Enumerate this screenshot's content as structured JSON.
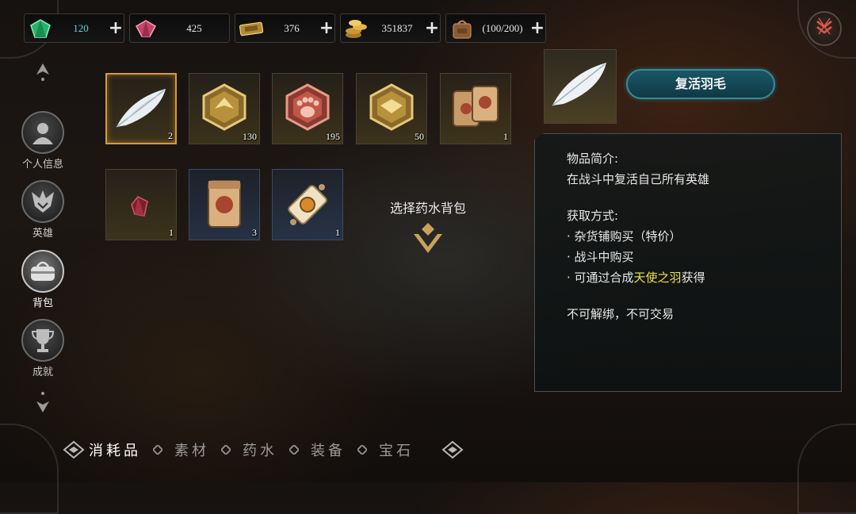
{
  "resources": [
    {
      "id": "emerald",
      "value": "120",
      "icon": "green-gem-icon",
      "color": "#5fd6c9"
    },
    {
      "id": "ruby",
      "value": "425",
      "icon": "pink-gem-icon"
    },
    {
      "id": "ticket",
      "value": "376",
      "icon": "gold-ticket-icon"
    },
    {
      "id": "gold",
      "value": "351837",
      "icon": "gold-coins-icon"
    },
    {
      "id": "bag",
      "value": "(100/200)",
      "icon": "backpack-icon"
    }
  ],
  "nav": {
    "items": [
      {
        "label": "个人信息",
        "icon": "profile-icon"
      },
      {
        "label": "英雄",
        "icon": "hero-emblem-icon"
      },
      {
        "label": "背包",
        "icon": "bag-icon"
      },
      {
        "label": "成就",
        "icon": "trophy-icon"
      }
    ],
    "active": "背包"
  },
  "inventory": {
    "row1": [
      {
        "item": "feather",
        "count": "2"
      },
      {
        "item": "gold-hexagon-token",
        "count": "130"
      },
      {
        "item": "red-paw-token",
        "count": "195"
      },
      {
        "item": "gold-crest-token",
        "count": "50"
      },
      {
        "item": "seed-bag-bundle",
        "count": "1"
      }
    ],
    "row2": [
      {
        "item": "red-crystal",
        "count": "1"
      },
      {
        "item": "seed-bag",
        "count": "3"
      },
      {
        "item": "scroll",
        "count": "1"
      }
    ]
  },
  "potion_hint": "选择药水背包",
  "detail": {
    "name": "复活羽毛",
    "intro_title": "物品简介:",
    "intro_text": "在战斗中复活自己所有英雄",
    "source_title": "获取方式:",
    "source_1": "· 杂货铺购买（特价）",
    "source_2": "· 战斗中购买",
    "source_3_prefix": "· 可通过合成",
    "source_3_highlight": "天使之羽",
    "source_3_suffix": "获得",
    "binding": "不可解绑，不可交易"
  },
  "tabs": [
    "消耗品",
    "素材",
    "药水",
    "装备",
    "宝石"
  ],
  "active_tab": "消耗品",
  "colors": {
    "highlight": "#f0e14a",
    "name_plate": "#1b5665",
    "selected_border": "#d59a3a"
  }
}
